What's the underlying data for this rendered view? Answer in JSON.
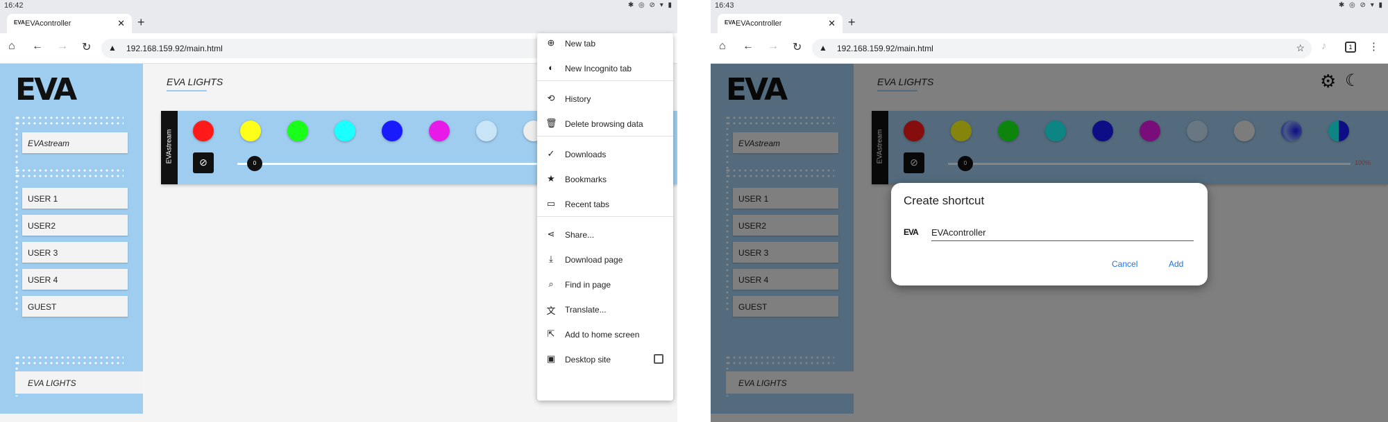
{
  "left": {
    "status_time": "16:42",
    "status_icons": "✱ ◎ ⊘ ▾ ▮",
    "tab_title": "EVAcontroller",
    "tab_favicon": "EVA",
    "url": "192.168.159.92/main.html",
    "menu": {
      "items": [
        {
          "icon": "⊕",
          "icon_name": "new-tab-icon",
          "label": "New tab"
        },
        {
          "icon": "◐",
          "icon_name": "incognito-icon",
          "label": "New Incognito tab"
        },
        {
          "icon": "⟲",
          "icon_name": "history-icon",
          "label": "History"
        },
        {
          "icon": "🗑",
          "icon_name": "trash-icon",
          "label": "Delete browsing data"
        },
        {
          "icon": "✓",
          "icon_name": "downloads-icon",
          "label": "Downloads"
        },
        {
          "icon": "★",
          "icon_name": "bookmarks-icon",
          "label": "Bookmarks"
        },
        {
          "icon": "▭",
          "icon_name": "recent-tabs-icon",
          "label": "Recent tabs"
        },
        {
          "icon": "⋖",
          "icon_name": "share-icon",
          "label": "Share..."
        },
        {
          "icon": "⤓",
          "icon_name": "download-page-icon",
          "label": "Download page"
        },
        {
          "icon": "⌕",
          "icon_name": "find-in-page-icon",
          "label": "Find in page"
        },
        {
          "icon": "文",
          "icon_name": "translate-icon",
          "label": "Translate..."
        },
        {
          "icon": "⇱",
          "icon_name": "add-to-home-icon",
          "label": "Add to home screen"
        },
        {
          "icon": "▣",
          "icon_name": "desktop-site-icon",
          "label": "Desktop site"
        }
      ]
    }
  },
  "right": {
    "status_time": "16:43",
    "status_icons": "✱ ◎ ⊘ ▾ ▮",
    "tab_title": "EVAcontroller",
    "tab_favicon": "EVA",
    "url": "192.168.159.92/main.html",
    "tab_count": "1",
    "dialog": {
      "title": "Create shortcut",
      "logo": "EVA",
      "input_value": "EVAcontroller",
      "cancel": "Cancel",
      "add": "Add"
    }
  },
  "app": {
    "logo": "EVA",
    "stream_label": "EVAstream",
    "users": [
      "USER 1",
      "USER2",
      "USER 3",
      "USER 4",
      "GUEST"
    ],
    "nav_bottom": "EVA LIGHTS",
    "heading": "EVA LIGHTS",
    "panel_label": "EVAstream",
    "slider_value": "0",
    "slider_pct": "100%",
    "colors": [
      "#ff1a1a",
      "#ffff1a",
      "#1aff1a",
      "#1affff",
      "#1a1aff",
      "#e81ae8",
      "#c8e4f7",
      "#ededed",
      "#2a4fd6",
      "#1a8fd6"
    ]
  }
}
